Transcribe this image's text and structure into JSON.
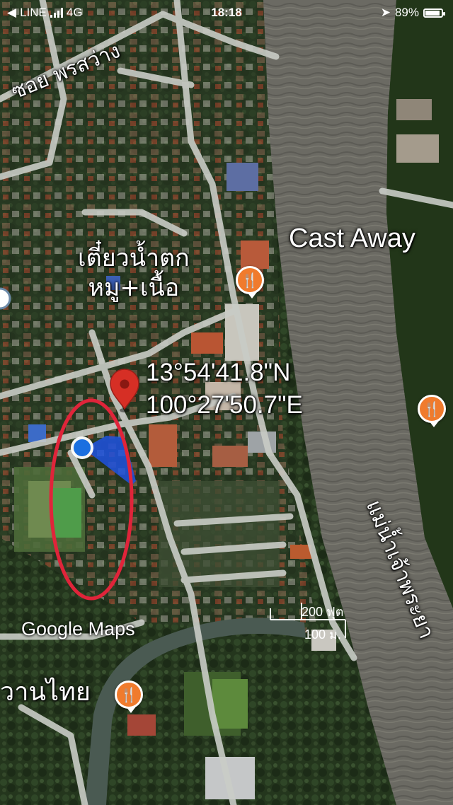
{
  "status_bar": {
    "carrier": "LINE",
    "network": "4G",
    "time": "18:18",
    "battery": "89%",
    "battery_level": 0.89
  },
  "map": {
    "street_label": "ซอย พรสว่าง",
    "place_label_line1": "เตี๋ยวน้ำตก",
    "place_label_line2": "หมู+เนื้อ",
    "castaway_label": "Cast Away",
    "pin_latitude": "13°54'41.8\"N",
    "pin_longitude": "100°27'50.7\"E",
    "river_label": "แม่น้ำเจ้าพระยา",
    "bottom_place_label": "วานไทย",
    "food_icon_glyph": "🍴",
    "scale": {
      "top": "200 ฟุต",
      "bottom": "100 ม."
    },
    "attribution_google": "Google",
    "attribution_maps": "Maps",
    "colors": {
      "river": "#6b6a63",
      "vegetation": "#2b3d22",
      "road": "#c9ccc6",
      "pin_red": "#d62f25",
      "location_blue": "#1a6fe0",
      "highlight_ellipse": "#e0243a",
      "food_pin": "#f07b2d"
    }
  }
}
